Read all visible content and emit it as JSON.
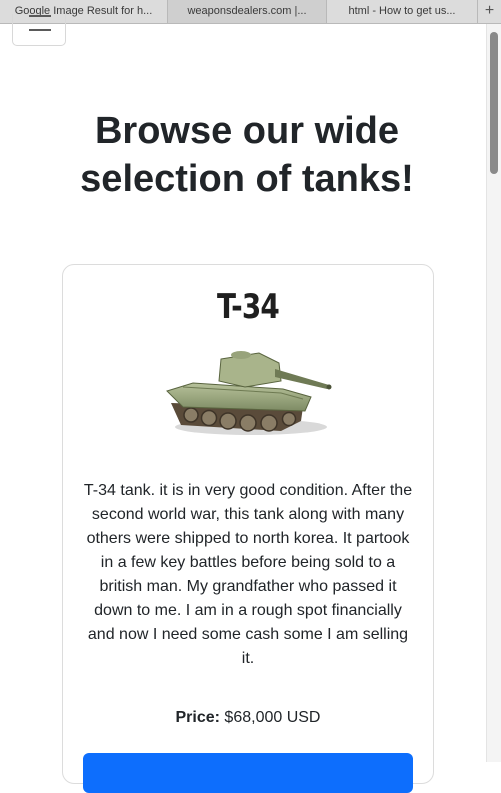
{
  "browser": {
    "tabs": [
      {
        "label": "Google Image Result for h..."
      },
      {
        "label": "weaponsdealers.com |..."
      },
      {
        "label": "html - How to get us..."
      }
    ],
    "new_tab_symbol": "+"
  },
  "navbar": {
    "toggler_icon": "hamburger-icon"
  },
  "page": {
    "title": "Browse our wide selection of tanks!"
  },
  "card": {
    "title": "T-34",
    "description": "T-34 tank. it is in very good condition. After the second world war, this tank along with many others were shipped to north korea. It partook in a few key battles before being sold to a british man. My grandfather who passed it down to me. I am in a rough spot financially and now I need some cash some I am selling it.",
    "price_label": "Price:",
    "price_value": "$68,000 USD",
    "button_color": "#0d6efd"
  }
}
